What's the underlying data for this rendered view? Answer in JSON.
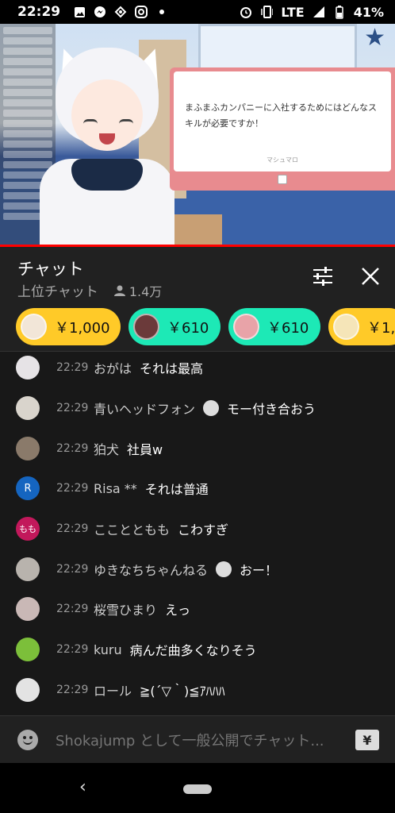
{
  "status_bar": {
    "time": "22:29",
    "network": "LTE",
    "battery": "41%",
    "left_icons": [
      "gallery-icon",
      "messenger-icon",
      "vpn-icon",
      "instagram-icon",
      "dot-icon"
    ],
    "right_icons": [
      "alarm-icon",
      "vibrate-icon",
      "signal-icon",
      "battery-icon"
    ]
  },
  "video": {
    "marshmallow_question": "まふまふカンパニーに入社するためにはどんなスキルが必要ですか！",
    "marshmallow_signature": "マシュマロ"
  },
  "chat_header": {
    "title": "チャット",
    "mode": "上位チャット",
    "viewer_count": "1.4万"
  },
  "ticker": [
    {
      "amount": "￥1,000",
      "color": "#ffca28",
      "avatar_color": "#f2e6d8"
    },
    {
      "amount": "￥610",
      "color": "#1de9b6",
      "avatar_color": "#6b3a3a"
    },
    {
      "amount": "￥610",
      "color": "#1de9b6",
      "avatar_color": "#e8a3a8"
    },
    {
      "amount": "￥1,",
      "color": "#ffca28",
      "avatar_color": "#f5e5b8"
    }
  ],
  "messages": [
    {
      "time": "22:29",
      "author": "おがは",
      "text": "それは最高",
      "avatar_color": "#e6e3e6",
      "avatar_letter": ""
    },
    {
      "time": "22:29",
      "author": "青いヘッドフォン",
      "text": "モー付き合おう",
      "avatar_color": "#d9d4cc",
      "avatar_letter": "",
      "badge": true
    },
    {
      "time": "22:29",
      "author": "狛犬",
      "text": "社員w",
      "avatar_color": "#8a7a6a",
      "avatar_letter": ""
    },
    {
      "time": "22:29",
      "author": "Risa **",
      "text": "それは普通",
      "avatar_color": "#1565c0",
      "avatar_letter": "R"
    },
    {
      "time": "22:29",
      "author": "こことともも",
      "text": "こわすぎ",
      "avatar_color": "#c2185b",
      "avatar_letter": "もも"
    },
    {
      "time": "22:29",
      "author": "ゆきなちちゃんねる",
      "text": "おー！",
      "avatar_color": "#b8b3ad",
      "avatar_letter": "",
      "badge": true
    },
    {
      "time": "22:29",
      "author": "桜雪ひまり",
      "text": "えっ",
      "avatar_color": "#c9b8b6",
      "avatar_letter": ""
    },
    {
      "time": "22:29",
      "author": "kuru",
      "text": "病んだ曲多くなりそう",
      "avatar_color": "#7cbf3a",
      "avatar_letter": ""
    },
    {
      "time": "22:29",
      "author": "ロール",
      "text": "≧(´▽｀)≦ｱﾊﾊﾊ",
      "avatar_color": "#e3e3e3",
      "avatar_letter": ""
    }
  ],
  "input": {
    "placeholder": "Shokajump として一般公開でチャット...",
    "superchat_label": "¥"
  }
}
